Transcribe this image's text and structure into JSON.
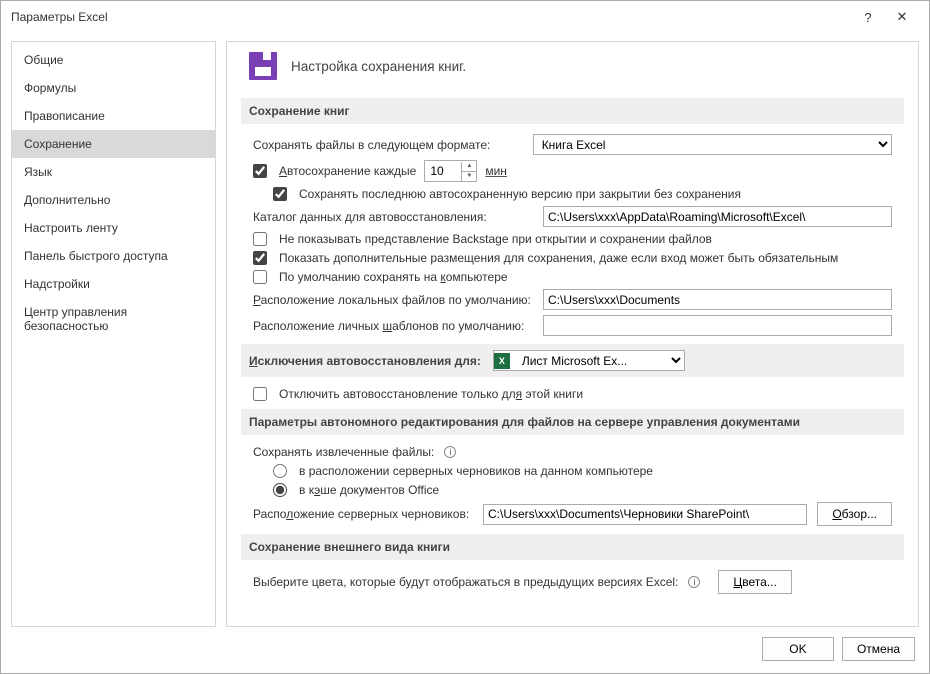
{
  "window": {
    "title": "Параметры Excel"
  },
  "sidebar": {
    "items": [
      {
        "label": "Общие"
      },
      {
        "label": "Формулы"
      },
      {
        "label": "Правописание"
      },
      {
        "label": "Сохранение",
        "selected": true
      },
      {
        "label": "Язык"
      },
      {
        "label": "Дополнительно"
      },
      {
        "label": "Настроить ленту"
      },
      {
        "label": "Панель быстрого доступа"
      },
      {
        "label": "Надстройки"
      },
      {
        "label": "Центр управления безопасностью"
      }
    ]
  },
  "header": {
    "text": "Настройка сохранения книг."
  },
  "section_save": {
    "title": "Сохранение книг",
    "format_label": "Сохранять файлы в следующем формате:",
    "format_value": "Книга Excel",
    "autosave_label": "Автосохранение каждые",
    "autosave_value": "10",
    "autosave_unit": "мин",
    "keep_last_label": "Сохранять последнюю автосохраненную версию при закрытии без сохранения",
    "autorecover_dir_label": "Каталог данных для автовосстановления:",
    "autorecover_dir_value": "C:\\Users\\xxx\\AppData\\Roaming\\Microsoft\\Excel\\",
    "no_backstage_label": "Не показывать представление Backstage при открытии и сохранении файлов",
    "show_addl_label": "Показать дополнительные размещения для сохранения, даже если вход может быть обязательным",
    "save_local_label": "По умолчанию сохранять на компьютере",
    "local_files_label": "Расположение локальных файлов по умолчанию:",
    "local_files_value": "C:\\Users\\xxx\\Documents",
    "templates_label": "Расположение личных шаблонов по умолчанию:",
    "templates_value": ""
  },
  "section_except": {
    "title_prefix": "Исключения автовосстановления для:",
    "workbook_value": "Лист Microsoft Ex...",
    "disable_label": "Отключить автовосстановление только для этой книги"
  },
  "section_offline": {
    "title": "Параметры автономного редактирования для файлов на сервере управления документами",
    "save_checked_label": "Сохранять извлеченные файлы:",
    "opt_server_drafts": "в расположении серверных черновиков на данном компьютере",
    "opt_office_cache": "в кэше документов Office",
    "drafts_loc_label": "Расположение серверных черновиков:",
    "drafts_loc_value": "C:\\Users\\xxx\\Documents\\Черновики SharePoint\\",
    "browse_btn": "Обзор..."
  },
  "section_visual": {
    "title": "Сохранение внешнего вида книги",
    "colors_text": "Выберите цвета, которые будут отображаться в предыдущих версиях Excel:",
    "colors_btn": "Цвета..."
  },
  "footer": {
    "ok": "OK",
    "cancel": "Отмена"
  }
}
